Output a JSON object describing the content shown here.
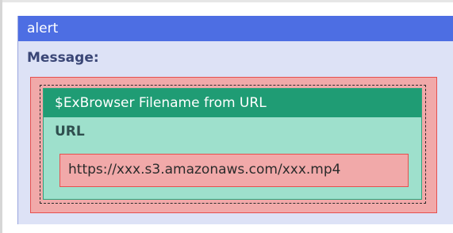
{
  "alert": {
    "title": "alert",
    "message_label": "Message:"
  },
  "function_block": {
    "title": "$ExBrowser Filename from URL",
    "url_label": "URL",
    "url_value": "https://xxx.s3.amazonaws.com/xxx.mp4"
  },
  "colors": {
    "alert_header": "#4d6ee3",
    "alert_body": "#dde2f6",
    "function_header": "#1f9c74",
    "function_body": "#9ee0cc",
    "drop_zone": "#f1a9a9",
    "drop_zone_border": "#e6504f"
  }
}
